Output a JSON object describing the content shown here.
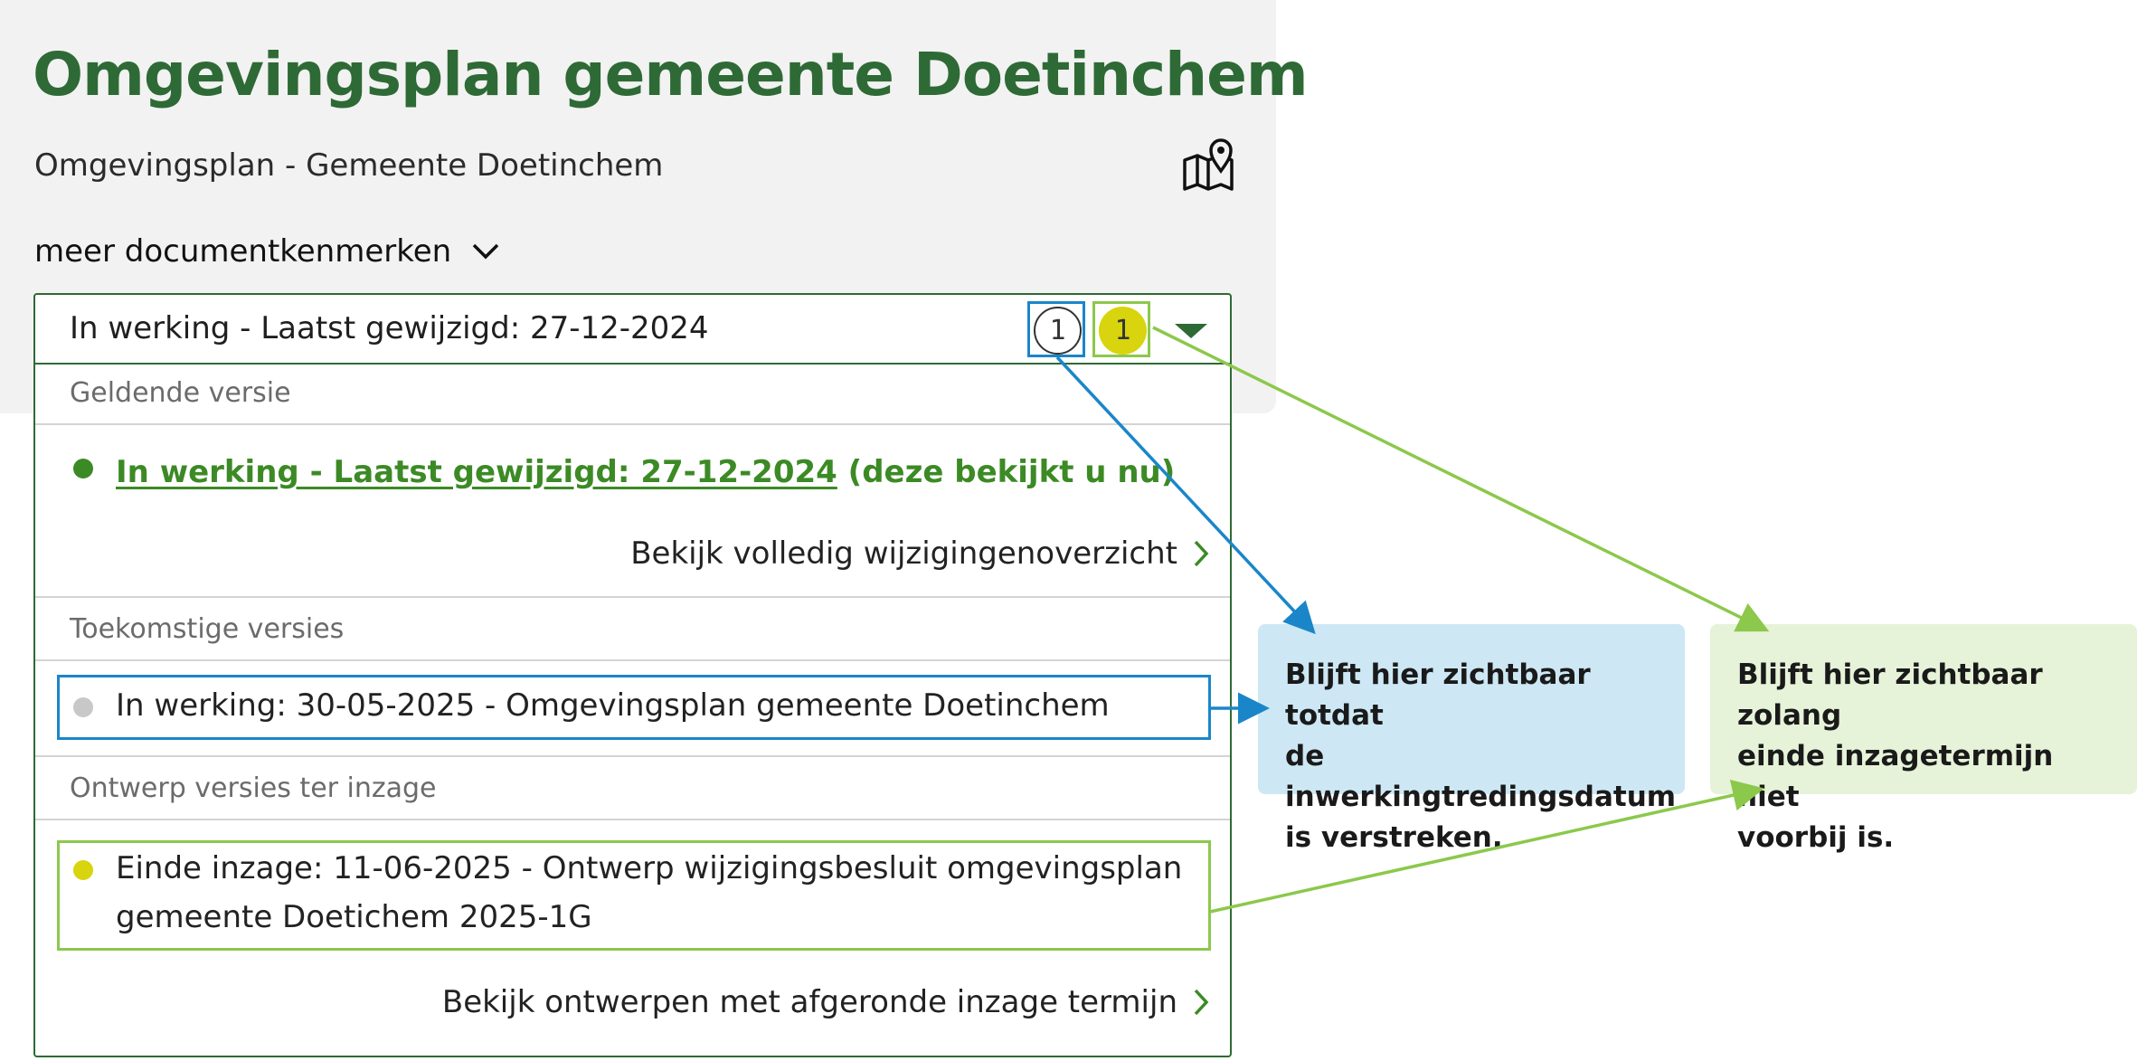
{
  "header": {
    "title": "Omgevingsplan gemeente Doetinchem",
    "subtitle": "Omgevingsplan - Gemeente Doetinchem",
    "map_icon": "map-pin-icon",
    "meer_label": "meer documentkenmerken"
  },
  "dropdown": {
    "selected": "In werking - Laatst gewijzigd: 27-12-2024",
    "badge_future": "1",
    "badge_draft": "1",
    "sections": {
      "current": {
        "label": "Geldende versie",
        "link": "In werking - Laatst gewijzigd: 27-12-2024",
        "suffix": " (deze bekijkt u nu)",
        "more": "Bekijk volledig wijzigingenoverzicht"
      },
      "future": {
        "label": "Toekomstige versies",
        "item": "In werking: 30-05-2025 - Omgevingsplan gemeente Doetinchem"
      },
      "draft": {
        "label": "Ontwerp versies ter inzage",
        "item_line1": "Einde inzage: 11-06-2025 - Ontwerp wijzigingsbesluit omgevingsplan",
        "item_line2": "gemeente Doetichem 2025-1G",
        "more": "Bekijk ontwerpen met afgeronde inzage termijn"
      }
    }
  },
  "callouts": {
    "blue": [
      "Blijft hier zichtbaar totdat",
      "de inwerkingtredingsdatum",
      "is verstreken."
    ],
    "green": [
      "Blijft hier zichtbaar zolang",
      "einde inzagetermijn niet",
      "voorbij is."
    ]
  },
  "colors": {
    "brand_green": "#2e6a35",
    "link_green": "#3c8a25",
    "annotation_blue": "#1a86c9",
    "annotation_green": "#8cc84b",
    "badge_yellow": "#d8d40e"
  }
}
